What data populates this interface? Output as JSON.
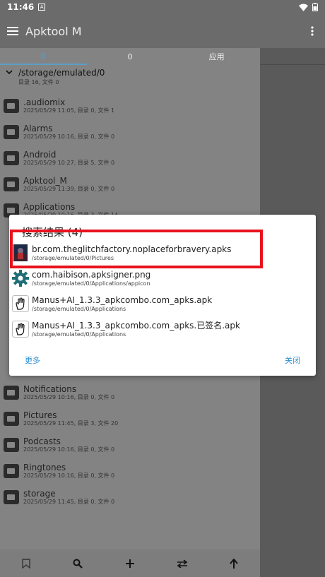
{
  "status_bar": {
    "time": "11:46",
    "a_label": "A"
  },
  "app_bar": {
    "title": "Apktool M"
  },
  "tabs": [
    {
      "label": "0"
    },
    {
      "label": "0"
    },
    {
      "label": "应用"
    }
  ],
  "path": {
    "current": "/storage/emulated/0",
    "summary": "目录 16, 文件 0"
  },
  "files": [
    {
      "name": ".audiomix",
      "meta": "2025/05/29 11:05, 目录 0, 文件 1"
    },
    {
      "name": "Alarms",
      "meta": "2025/05/29 10:16, 目录 0, 文件 0"
    },
    {
      "name": "Android",
      "meta": "2025/05/29 10:27, 目录 5, 文件 0"
    },
    {
      "name": "Apktool_M",
      "meta": "2025/05/29 11:39, 目录 0, 文件 0"
    },
    {
      "name": "Applications",
      "meta": "2025/05/29 10:16, 目录 3, 文件 14"
    },
    {
      "name": "Notifications",
      "meta": "2025/05/29 10:16, 目录 0, 文件 0"
    },
    {
      "name": "Pictures",
      "meta": "2025/05/29 11:45, 目录 3, 文件 20"
    },
    {
      "name": "Podcasts",
      "meta": "2025/05/29 10:16, 目录 0, 文件 0"
    },
    {
      "name": "Ringtones",
      "meta": "2025/05/29 10:16, 目录 0, 文件 0"
    },
    {
      "name": "storage",
      "meta": "2025/05/29 11:45, 目录 0, 文件 0"
    }
  ],
  "dialog": {
    "title": "搜索结果 (4)",
    "results": [
      {
        "name": "br.com.theglitchfactory.noplaceforbravery.apks",
        "path": "/storage/emulated/0/Pictures",
        "icon": "game-thumbnail-icon"
      },
      {
        "name": "com.haibison.apksigner.png",
        "path": "/storage/emulated/0/Applications/appicon",
        "icon": "gear-icon"
      },
      {
        "name": "Manus+AI_1.3.3_apkcombo.com_apks.apk",
        "path": "/storage/emulated/0/Applications",
        "icon": "hand-icon"
      },
      {
        "name": "Manus+AI_1.3.3_apkcombo.com_apks.已签名.apk",
        "path": "/storage/emulated/0/Applications",
        "icon": "hand-icon"
      }
    ],
    "more_label": "更多",
    "close_label": "关闭"
  },
  "colors": {
    "accent": "#2b8fd1",
    "highlight": "#e8121d",
    "gear": "#1f6f78"
  }
}
